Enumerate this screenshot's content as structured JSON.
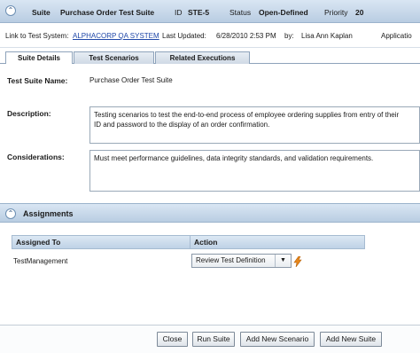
{
  "header": {
    "type_label": "Suite",
    "title": "Purchase Order Test Suite",
    "id_label": "ID",
    "id_value": "STE-5",
    "status_label": "Status",
    "status_value": "Open-Defined",
    "priority_label": "Priority",
    "priority_value": "20"
  },
  "info": {
    "link_label": "Link to Test System:",
    "link_value": "ALPHACORP QA SYSTEM",
    "updated_label": "Last Updated:",
    "updated_value": "6/28/2010 2:53 PM",
    "by_label": "by:",
    "by_value": "Lisa Ann Kaplan",
    "application_label": "Applicatio"
  },
  "tabs": [
    "Suite Details",
    "Test Scenarios",
    "Related Executions"
  ],
  "details": {
    "name_label": "Test Suite Name:",
    "name_value": "Purchase Order Test Suite",
    "description_label": "Description:",
    "description_line1": "Testing scenarios to test the end-to-end process of employee ordering supplies from entry of their",
    "description_line2": "ID and password to the display of an order confirmation.",
    "considerations_label": "Considerations:",
    "considerations_value": "Must meet performance guidelines, data integrity standards, and validation requirements."
  },
  "assignments": {
    "title": "Assignments",
    "columns": [
      "Assigned To",
      "Action"
    ],
    "rows": [
      {
        "assigned_to": "TestManagement",
        "action": "Review Test Definition"
      }
    ]
  },
  "buttons": {
    "close": "Close",
    "run_suite": "Run Suite",
    "add_scenario": "Add New Scenario",
    "add_suite": "Add New Suite"
  },
  "colors": {
    "header_gradient_top": "#d9e6f3",
    "header_gradient_bottom": "#b9cde2",
    "link": "#1f47a8",
    "lightning": "#e8871a"
  },
  "icons": [
    "collapse-icon",
    "dropdown-arrow-icon",
    "lightning-icon"
  ]
}
